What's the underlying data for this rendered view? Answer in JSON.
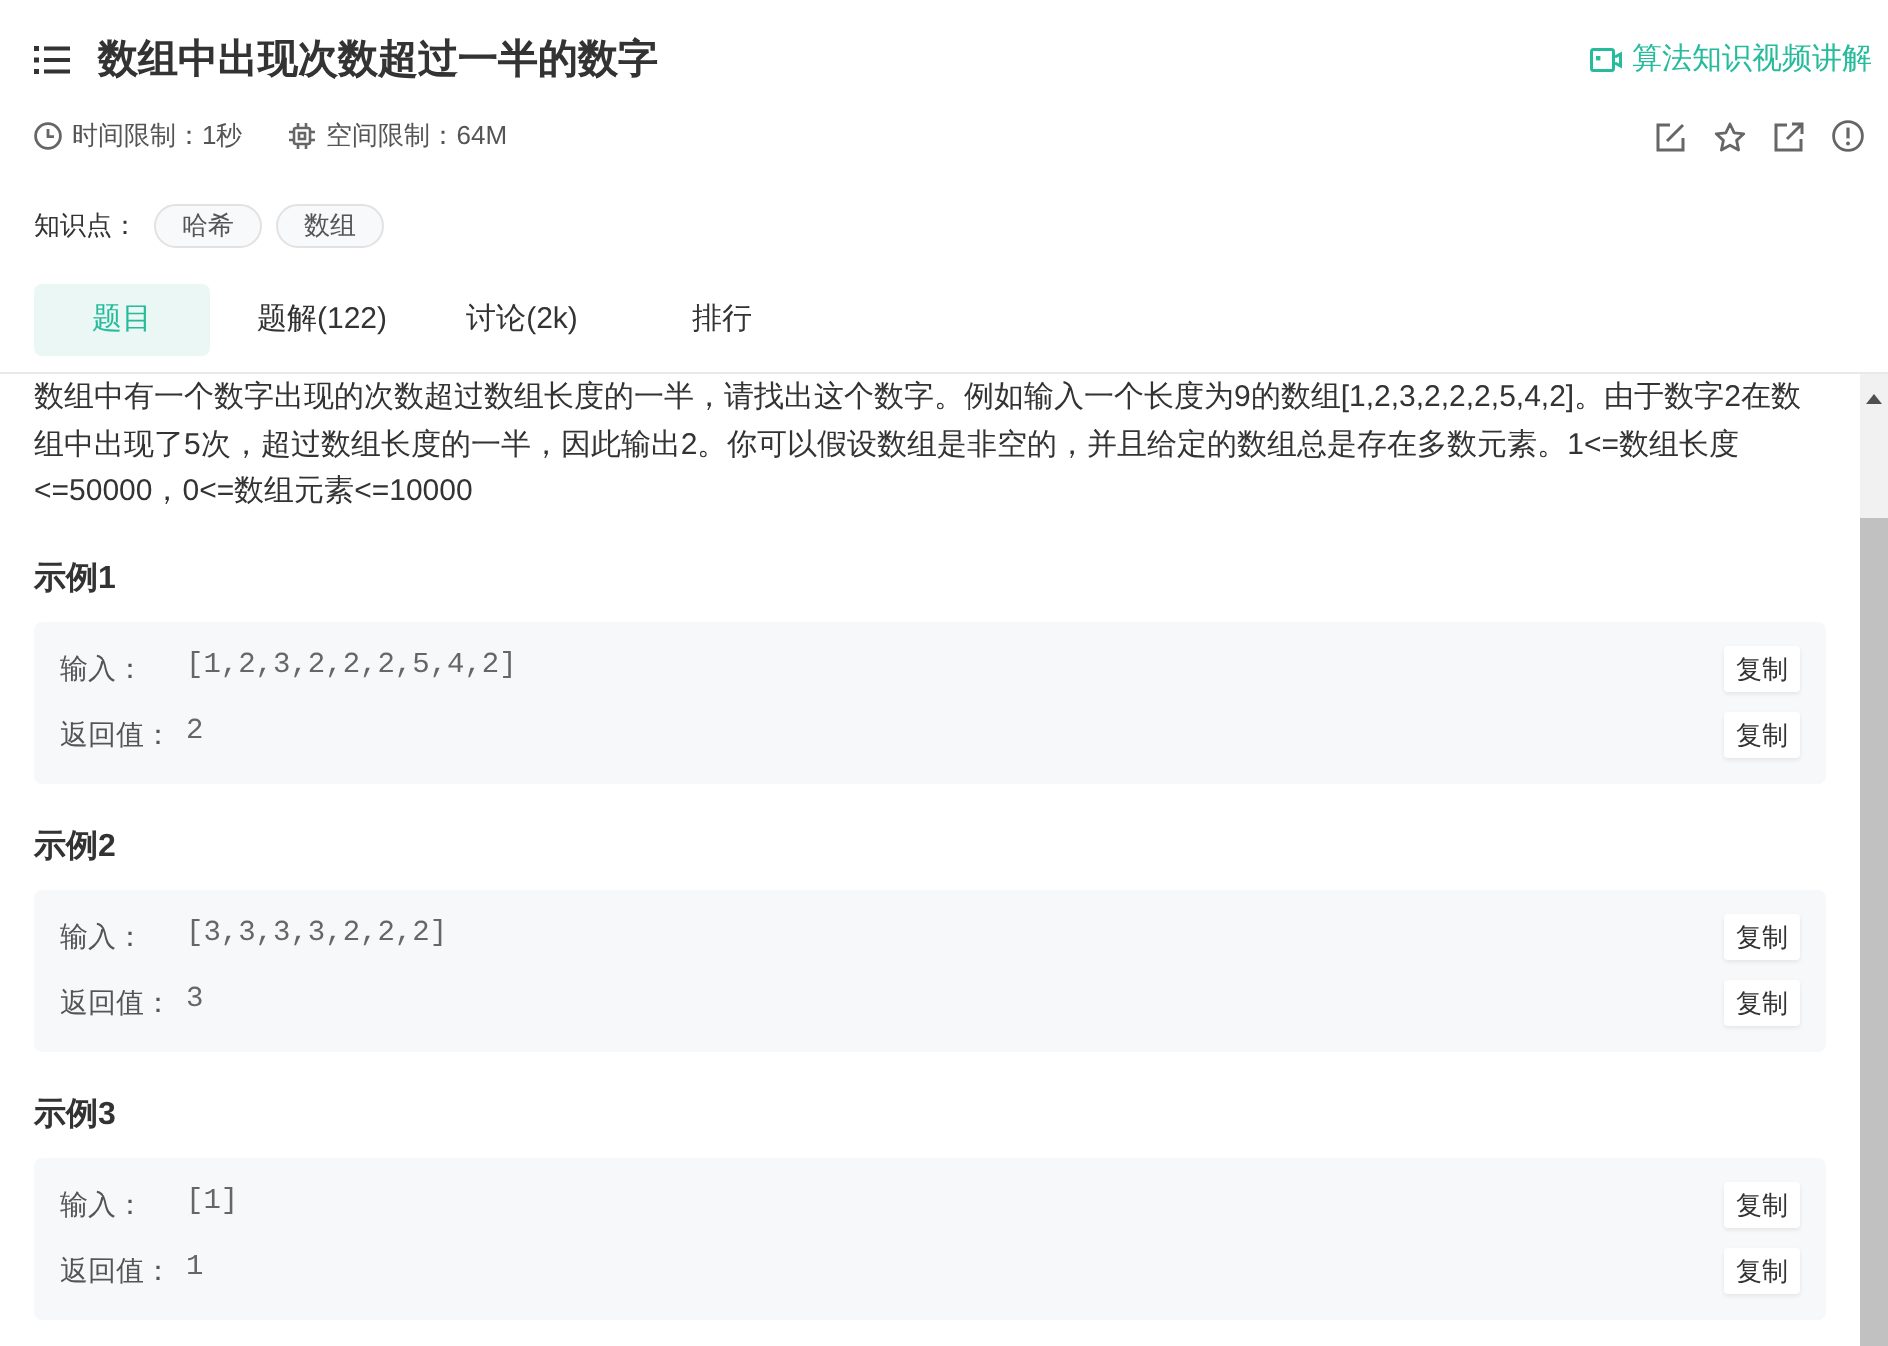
{
  "header": {
    "title": "数组中出现次数超过一半的数字",
    "video_link": "算法知识视频讲解"
  },
  "limits": [
    {
      "kind": "time",
      "text": "时间限制：1秒"
    },
    {
      "kind": "memory",
      "text": "空间限制：64M"
    }
  ],
  "knowledge": {
    "label": "知识点：",
    "tags": [
      "哈希",
      "数组"
    ]
  },
  "tabs": [
    {
      "label": "题目",
      "selected": true
    },
    {
      "label": "题解(122)",
      "selected": false
    },
    {
      "label": "讨论(2k)",
      "selected": false
    },
    {
      "label": "排行",
      "selected": false
    }
  ],
  "description": "数组中有一个数字出现的次数超过数组长度的一半，请找出这个数字。例如输入一个长度为9的数组[1,2,3,2,2,2,5,4,2]。由于数字2在数组中出现了5次，超过数组长度的一半，因此输出2。你可以假设数组是非空的，并且给定的数组总是存在多数元素。1<=数组长度<=50000，0<=数组元素<=10000",
  "examples": [
    {
      "title": "示例1",
      "rows": [
        {
          "label": "输入：",
          "value": "[1,2,3,2,2,2,5,4,2]",
          "copy": "复制"
        },
        {
          "label": "返回值：",
          "value": "2",
          "copy": "复制"
        }
      ]
    },
    {
      "title": "示例2",
      "rows": [
        {
          "label": "输入：",
          "value": "[3,3,3,3,2,2,2]",
          "copy": "复制"
        },
        {
          "label": "返回值：",
          "value": "3",
          "copy": "复制"
        }
      ]
    },
    {
      "title": "示例3",
      "rows": [
        {
          "label": "输入：",
          "value": "[1]",
          "copy": "复制"
        },
        {
          "label": "返回值：",
          "value": "1",
          "copy": "复制"
        }
      ]
    }
  ]
}
